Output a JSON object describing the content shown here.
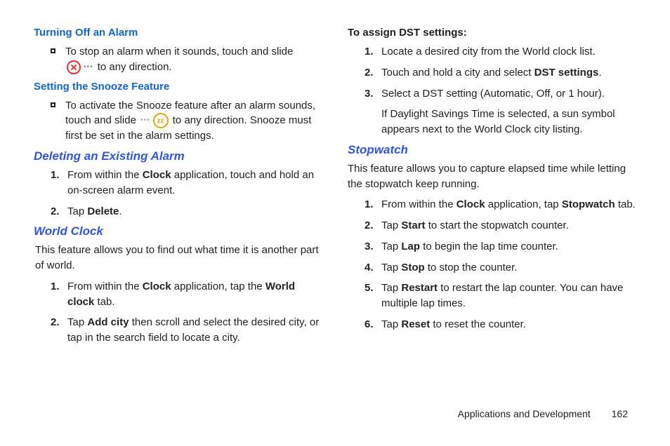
{
  "left": {
    "h1": "Turning Off an Alarm",
    "bullet1a": "To stop an alarm when it sounds, touch and slide ",
    "bullet1b": " to any direction.",
    "h2": "Setting the Snooze Feature",
    "bullet2a": "To activate the Snooze feature after an alarm sounds, touch and slide ",
    "bullet2b": " to any direction. Snooze must first be set in the alarm settings.",
    "h3": "Deleting an Existing Alarm",
    "del1a": "From within the ",
    "del1b": "Clock",
    "del1c": " application, touch and hold an on-screen alarm event.",
    "del2a": "Tap ",
    "del2b": "Delete",
    "del2c": ".",
    "h4": "World Clock",
    "wcIntro": "This feature allows you to find out what time it is another part of world.",
    "wc1a": "From within the ",
    "wc1b": "Clock",
    "wc1c": " application, tap the ",
    "wc1d": "World clock",
    "wc1e": " tab.",
    "wc2a": "Tap ",
    "wc2b": "Add city",
    "wc2c": " then scroll and select the desired city, or tap in the search field to locate a city."
  },
  "right": {
    "h1": "To assign DST settings:",
    "d1": "Locate a desired city from the World clock list.",
    "d2a": "Touch and hold a city and select ",
    "d2b": "DST settings",
    "d2c": ".",
    "d3": "Select a DST setting (Automatic, Off, or 1 hour).",
    "d3cont": "If Daylight Savings Time is selected, a sun symbol appears next to the World Clock city listing.",
    "h2": "Stopwatch",
    "swIntro": "This feature allows you to capture elapsed time while letting the stopwatch keep running.",
    "s1a": "From within the ",
    "s1b": "Clock",
    "s1c": " application, tap ",
    "s1d": "Stopwatch",
    "s1e": " tab.",
    "s2a": "Tap ",
    "s2b": "Start",
    "s2c": " to start the stopwatch counter.",
    "s3a": "Tap ",
    "s3b": "Lap",
    "s3c": " to begin the lap time counter.",
    "s4a": "Tap ",
    "s4b": "Stop",
    "s4c": " to stop the counter.",
    "s5a": "Tap ",
    "s5b": "Restart",
    "s5c": " to restart the lap counter. You can have multiple lap times.",
    "s6a": "Tap ",
    "s6b": "Reset",
    "s6c": " to reset the counter."
  },
  "nums": {
    "n1": "1.",
    "n2": "2.",
    "n3": "3.",
    "n4": "4.",
    "n5": "5.",
    "n6": "6."
  },
  "icons": {
    "zz": "zz",
    "dots": "•••"
  },
  "footer": {
    "section": "Applications and Development",
    "page": "162"
  }
}
